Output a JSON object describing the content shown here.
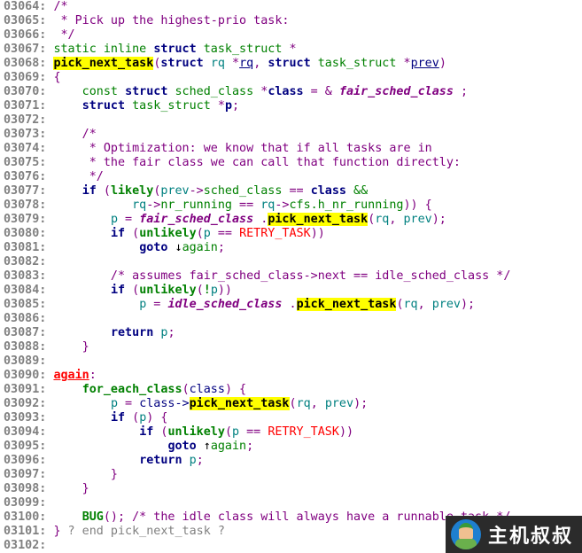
{
  "colors": {
    "comment": "#800080",
    "keyword": "#000080",
    "type": "#008000",
    "variable": "#008080",
    "highlight": "#ffff00",
    "macro": "#ff0000",
    "line_number": "#808080"
  },
  "watermark": {
    "text": "主机叔叔",
    "icon": "mechanic-avatar-icon"
  },
  "lines": [
    {
      "n": "03064:",
      "t": [
        [
          "/*",
          "c"
        ]
      ]
    },
    {
      "n": "03065:",
      "t": [
        [
          " * Pick up the highest-prio task:",
          "c"
        ]
      ]
    },
    {
      "n": "03066:",
      "t": [
        [
          " */",
          "c"
        ]
      ]
    },
    {
      "n": "03067:",
      "t": [
        [
          "static inline ",
          "t"
        ],
        [
          "struct",
          "k"
        ],
        [
          " task_struct ",
          "t"
        ],
        [
          "*",
          "o"
        ]
      ]
    },
    {
      "n": "03068:",
      "t": [
        [
          "pick_next_task",
          "h"
        ],
        [
          "(",
          "o"
        ],
        [
          "struct",
          "k"
        ],
        [
          " ",
          "o"
        ],
        [
          "rq",
          "v"
        ],
        [
          " *",
          "o"
        ],
        [
          "rq",
          "u"
        ],
        [
          ", ",
          "o"
        ],
        [
          "struct",
          "k"
        ],
        [
          " task_struct ",
          "t"
        ],
        [
          "*",
          "o"
        ],
        [
          "prev",
          "u"
        ],
        [
          ")",
          "o"
        ]
      ]
    },
    {
      "n": "03069:",
      "t": [
        [
          "{",
          "o"
        ]
      ]
    },
    {
      "n": "03070:",
      "t": [
        [
          "    const ",
          "t"
        ],
        [
          "struct",
          "k"
        ],
        [
          " sched_class ",
          "t"
        ],
        [
          "*",
          "o"
        ],
        [
          "class",
          "k"
        ],
        [
          " = & ",
          "o"
        ],
        [
          "fair_sched_class",
          "i"
        ],
        [
          " ;",
          "o"
        ]
      ]
    },
    {
      "n": "03071:",
      "t": [
        [
          "    ",
          "o"
        ],
        [
          "struct",
          "k"
        ],
        [
          " task_struct ",
          "t"
        ],
        [
          "*",
          "o"
        ],
        [
          "p",
          "k"
        ],
        [
          ";",
          "o"
        ]
      ]
    },
    {
      "n": "03072:",
      "t": []
    },
    {
      "n": "03073:",
      "t": [
        [
          "    /*",
          "c"
        ]
      ]
    },
    {
      "n": "03074:",
      "t": [
        [
          "     * Optimization: we know that if all tasks are in",
          "c"
        ]
      ]
    },
    {
      "n": "03075:",
      "t": [
        [
          "     * the fair class we can call that function directly:",
          "c"
        ]
      ]
    },
    {
      "n": "03076:",
      "t": [
        [
          "     */",
          "c"
        ]
      ]
    },
    {
      "n": "03077:",
      "t": [
        [
          "    ",
          "o"
        ],
        [
          "if",
          "k"
        ],
        [
          " (",
          "o"
        ],
        [
          "likely",
          "g"
        ],
        [
          "(",
          "o"
        ],
        [
          "prev",
          "v"
        ],
        [
          "->",
          "o"
        ],
        [
          "sched_class",
          "t"
        ],
        [
          " == ",
          "o"
        ],
        [
          "class",
          "k"
        ],
        [
          " &&",
          "t"
        ]
      ]
    },
    {
      "n": "03078:",
      "t": [
        [
          "           ",
          "o"
        ],
        [
          "rq",
          "v"
        ],
        [
          "->",
          "o"
        ],
        [
          "nr_running",
          "t"
        ],
        [
          " == ",
          "o"
        ],
        [
          "rq",
          "v"
        ],
        [
          "->",
          "o"
        ],
        [
          "cfs.h_nr_running",
          "t"
        ],
        [
          ")) {",
          "o"
        ]
      ]
    },
    {
      "n": "03079:",
      "t": [
        [
          "        ",
          "o"
        ],
        [
          "p",
          "v"
        ],
        [
          " = ",
          "o"
        ],
        [
          "fair_sched_class",
          "i"
        ],
        [
          " .",
          "o"
        ],
        [
          "pick_next_task",
          "h"
        ],
        [
          "(",
          "o"
        ],
        [
          "rq",
          "v"
        ],
        [
          ", ",
          "o"
        ],
        [
          "prev",
          "v"
        ],
        [
          ");",
          "o"
        ]
      ]
    },
    {
      "n": "03080:",
      "t": [
        [
          "        ",
          "o"
        ],
        [
          "if",
          "k"
        ],
        [
          " (",
          "o"
        ],
        [
          "unlikely",
          "g"
        ],
        [
          "(",
          "o"
        ],
        [
          "p",
          "v"
        ],
        [
          " == ",
          "o"
        ],
        [
          "RETRY_TASK",
          "r"
        ],
        [
          "))",
          "o"
        ]
      ]
    },
    {
      "n": "03081:",
      "t": [
        [
          "            ",
          "o"
        ],
        [
          "goto",
          "k"
        ],
        [
          " ↓",
          "ar"
        ],
        [
          "again",
          "t"
        ],
        [
          ";",
          "o"
        ]
      ]
    },
    {
      "n": "03082:",
      "t": []
    },
    {
      "n": "03083:",
      "t": [
        [
          "        /* assumes fair_sched_class->next == idle_sched_class */",
          "c"
        ]
      ]
    },
    {
      "n": "03084:",
      "t": [
        [
          "        ",
          "o"
        ],
        [
          "if",
          "k"
        ],
        [
          " (",
          "o"
        ],
        [
          "unlikely",
          "g"
        ],
        [
          "(",
          "o"
        ],
        [
          "!",
          "g"
        ],
        [
          "p",
          "v"
        ],
        [
          "))",
          "o"
        ]
      ]
    },
    {
      "n": "03085:",
      "t": [
        [
          "            ",
          "o"
        ],
        [
          "p",
          "v"
        ],
        [
          " = ",
          "o"
        ],
        [
          "idle_sched_class",
          "i"
        ],
        [
          " .",
          "o"
        ],
        [
          "pick_next_task",
          "h"
        ],
        [
          "(",
          "o"
        ],
        [
          "rq",
          "v"
        ],
        [
          ", ",
          "o"
        ],
        [
          "prev",
          "v"
        ],
        [
          ");",
          "o"
        ]
      ]
    },
    {
      "n": "03086:",
      "t": []
    },
    {
      "n": "03087:",
      "t": [
        [
          "        ",
          "o"
        ],
        [
          "return",
          "k"
        ],
        [
          " ",
          "o"
        ],
        [
          "p",
          "v"
        ],
        [
          ";",
          "o"
        ]
      ]
    },
    {
      "n": "03088:",
      "t": [
        [
          "    }",
          "o"
        ]
      ]
    },
    {
      "n": "03089:",
      "t": []
    },
    {
      "n": "03090:",
      "t": [
        [
          "again",
          "lbl"
        ],
        [
          ":",
          "o"
        ]
      ]
    },
    {
      "n": "03091:",
      "t": [
        [
          "    ",
          "o"
        ],
        [
          "for_each_class",
          "g"
        ],
        [
          "(",
          "o"
        ],
        [
          "class",
          "n"
        ],
        [
          ") {",
          "o"
        ]
      ]
    },
    {
      "n": "03092:",
      "t": [
        [
          "        ",
          "o"
        ],
        [
          "p",
          "v"
        ],
        [
          " = ",
          "o"
        ],
        [
          "class->",
          "n"
        ],
        [
          "pick_next_task",
          "h"
        ],
        [
          "(",
          "o"
        ],
        [
          "rq",
          "v"
        ],
        [
          ", ",
          "o"
        ],
        [
          "prev",
          "v"
        ],
        [
          ");",
          "o"
        ]
      ]
    },
    {
      "n": "03093:",
      "t": [
        [
          "        ",
          "o"
        ],
        [
          "if",
          "k"
        ],
        [
          " (",
          "o"
        ],
        [
          "p",
          "v"
        ],
        [
          ") {",
          "o"
        ]
      ]
    },
    {
      "n": "03094:",
      "t": [
        [
          "            ",
          "o"
        ],
        [
          "if",
          "k"
        ],
        [
          " (",
          "o"
        ],
        [
          "unlikely",
          "g"
        ],
        [
          "(",
          "o"
        ],
        [
          "p",
          "v"
        ],
        [
          " == ",
          "o"
        ],
        [
          "RETRY_TASK",
          "r"
        ],
        [
          "))",
          "o"
        ]
      ]
    },
    {
      "n": "03095:",
      "t": [
        [
          "                ",
          "o"
        ],
        [
          "goto",
          "k"
        ],
        [
          " ↑",
          "ar"
        ],
        [
          "again",
          "t"
        ],
        [
          ";",
          "o"
        ]
      ]
    },
    {
      "n": "03096:",
      "t": [
        [
          "            ",
          "o"
        ],
        [
          "return",
          "k"
        ],
        [
          " ",
          "o"
        ],
        [
          "p",
          "v"
        ],
        [
          ";",
          "o"
        ]
      ]
    },
    {
      "n": "03097:",
      "t": [
        [
          "        }",
          "o"
        ]
      ]
    },
    {
      "n": "03098:",
      "t": [
        [
          "    }",
          "o"
        ]
      ]
    },
    {
      "n": "03099:",
      "t": []
    },
    {
      "n": "03100:",
      "t": [
        [
          "    ",
          "o"
        ],
        [
          "BUG",
          "g"
        ],
        [
          "(); ",
          "o"
        ],
        [
          "/* the idle class will always have a runnable task */",
          "c"
        ]
      ]
    },
    {
      "n": "03101:",
      "t": [
        [
          "}",
          "o"
        ],
        [
          " ? end pick_next_task ?",
          "gr"
        ]
      ]
    },
    {
      "n": "03102:",
      "t": []
    }
  ]
}
